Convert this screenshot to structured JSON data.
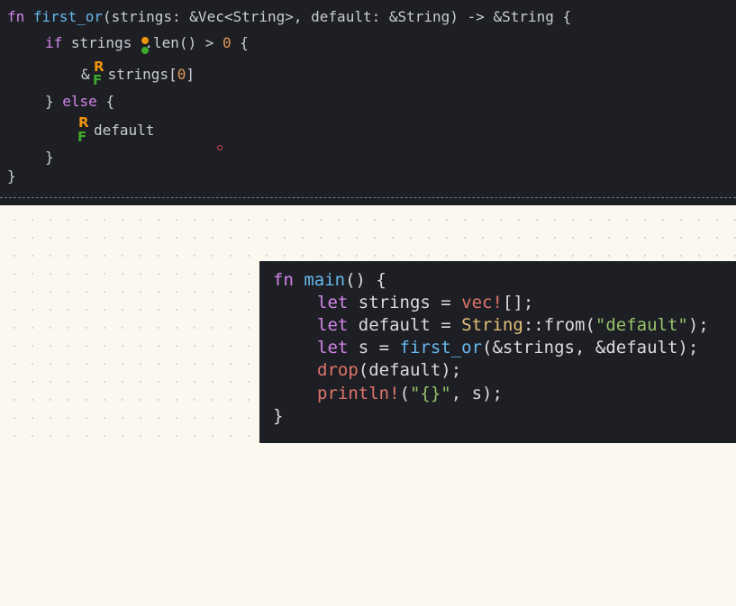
{
  "top_code": {
    "l1": {
      "kw": "fn",
      "name": "first_or",
      "params": "(strings: &Vec<String>, default: &String) -> &String {"
    },
    "l2": {
      "kw": "if",
      "pre": " strings",
      "post": ".len() > ",
      "num": "0",
      "end": " {"
    },
    "l3": {
      "amp": "&",
      "ident": "strings[",
      "idx": "0",
      "close": "]"
    },
    "l4": {
      "close": "}",
      "kw": " else",
      "brace": " {"
    },
    "l5": {
      "ident": "default"
    },
    "l6": {
      "close": "}"
    },
    "l7": {
      "close": "}"
    }
  },
  "markers": {
    "r": "R",
    "f": "F"
  },
  "main_code": {
    "l1": {
      "kw": "fn",
      "name": "main",
      "rest": "() {"
    },
    "l2": {
      "kw": "let",
      "a": " strings = ",
      "mac": "vec!",
      "b": "[];"
    },
    "l3": {
      "kw": "let",
      "a": " default = ",
      "ty": "String",
      "b": "::from(",
      "str": "\"default\"",
      "c": ");"
    },
    "l4": {
      "kw": "let",
      "a": " s = ",
      "fn": "first_or",
      "b": "(&strings, &default);"
    },
    "l5": {
      "fn": "drop",
      "b": "(default);"
    },
    "l6": {
      "mac": "println!",
      "a": "(",
      "str": "\"{}\"",
      "b": ", s);"
    },
    "l7": {
      "close": "}"
    }
  },
  "colors": {
    "keyword": "#d186e8",
    "function": "#67b9ee",
    "type": "#e5c07b",
    "number": "#e49b57",
    "string": "#95c26b",
    "macro": "#e0746b",
    "marker_r": "#f0950b",
    "marker_f": "#3fa82c"
  }
}
